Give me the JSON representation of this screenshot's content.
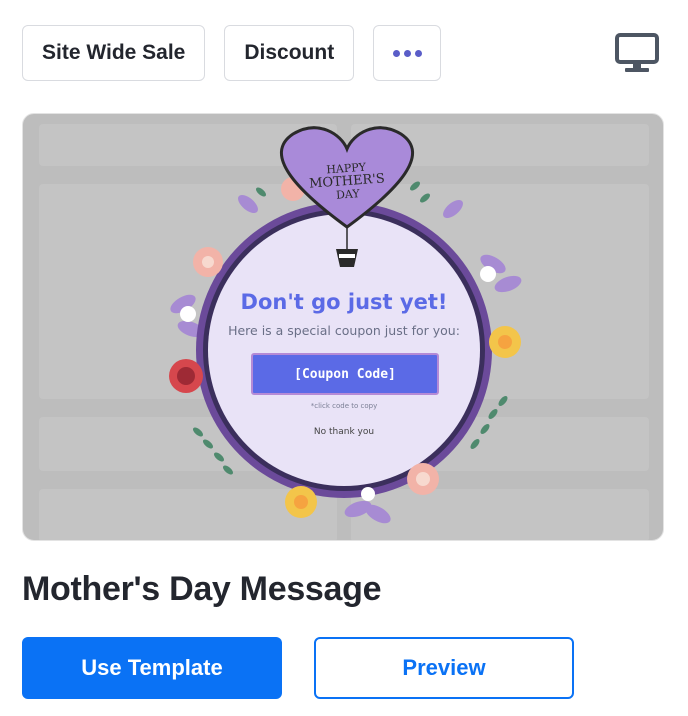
{
  "tags": [
    "Site Wide Sale",
    "Discount"
  ],
  "more_label": "•••",
  "icons": {
    "more": "more-dots-icon",
    "device": "desktop-monitor-icon"
  },
  "popup": {
    "balloon_text": [
      "HAPPY",
      "MOTHER'S",
      "DAY"
    ],
    "headline": "Don't go just yet!",
    "subtext": "Here is a special coupon just for you:",
    "coupon_button": "[Coupon Code]",
    "hint": "*click code to copy",
    "decline": "No thank you"
  },
  "template": {
    "title": "Mother's Day Message"
  },
  "actions": {
    "use": "Use Template",
    "preview": "Preview"
  },
  "colors": {
    "accent": "#0a72f5",
    "popup_purple": "#5b6ae6",
    "heart": "#a98ad9",
    "frame": "#6b4a9a"
  }
}
